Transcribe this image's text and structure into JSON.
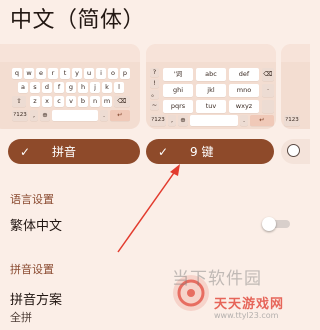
{
  "header": {
    "title": "中文（简体）"
  },
  "keyboards": {
    "qwerty": {
      "row1": [
        "q",
        "w",
        "e",
        "r",
        "t",
        "y",
        "u",
        "i",
        "o",
        "p"
      ],
      "row2": [
        "a",
        "s",
        "d",
        "f",
        "g",
        "h",
        "j",
        "k",
        "l"
      ],
      "row3": [
        "z",
        "x",
        "c",
        "v",
        "b",
        "n",
        "m"
      ],
      "num_key": "?123",
      "comma_key": ",",
      "period_key": ".",
      "label": "拼音",
      "selected": true
    },
    "nine_key": {
      "side_symbols": [
        "?",
        "!",
        "。",
        "~"
      ],
      "rows": [
        [
          "'词",
          "abc",
          "def"
        ],
        [
          "ghi",
          "jkl",
          "mno"
        ],
        [
          "pqrs",
          "tuv",
          "wxyz"
        ]
      ],
      "num_key": "?123",
      "comma_key": ",",
      "period_key": ".",
      "label": "9 键",
      "selected": true
    },
    "third": {
      "num_key": "?123",
      "selected": false
    }
  },
  "language_section": {
    "header": "语言设置",
    "traditional": {
      "title": "繁体中文",
      "enabled": false
    }
  },
  "pinyin_section": {
    "header": "拼音设置",
    "scheme": {
      "title": "拼音方案",
      "value": "全拼"
    }
  },
  "watermark": {
    "brand": "当下软件园",
    "sub_title": "天天游戏网",
    "url": "www.ttyl23.com"
  },
  "colors": {
    "background": "#fbeee7",
    "pill": "#8e4a2a",
    "section_header": "#8a4a30",
    "arrow": "#e23b2e"
  },
  "icons": [
    "check-icon",
    "globe-icon",
    "backspace-icon",
    "shift-icon",
    "enter-icon",
    "radio-icon",
    "arrow-annotation"
  ]
}
